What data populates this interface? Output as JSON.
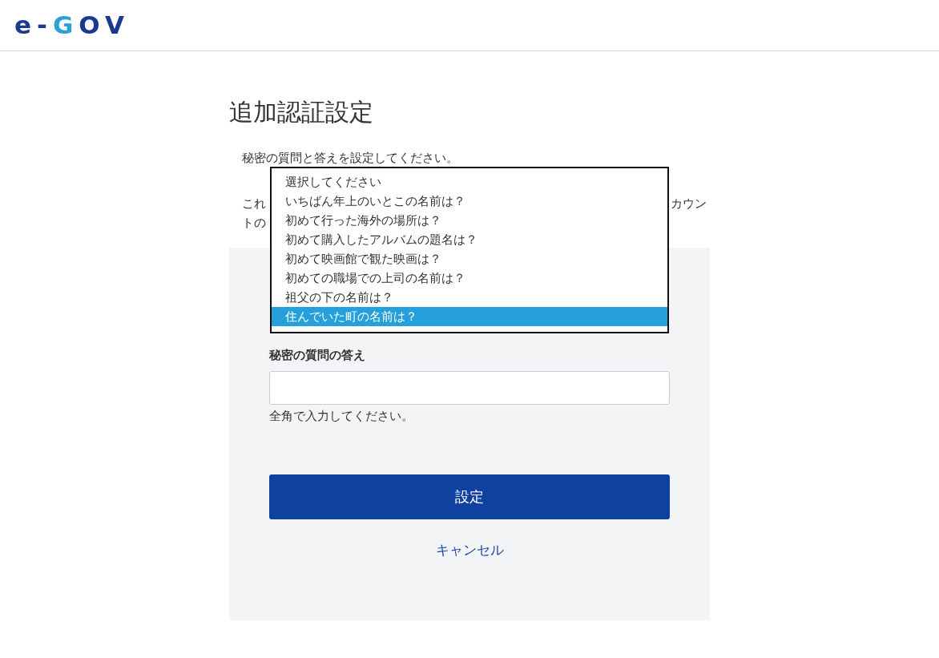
{
  "logo": {
    "parts": [
      {
        "text": "e-",
        "color": "#1b3a8f"
      },
      {
        "text": "G",
        "color": "#2a9fd8"
      },
      {
        "text": "OV",
        "color": "#1b3a8f"
      }
    ]
  },
  "title": "追加認証設定",
  "instruction": "秘密の質問と答えを設定してください。",
  "paragraph_fragments": [
    {
      "left": "これ",
      "right": "カウン"
    },
    {
      "left": "トの"
    }
  ],
  "dropdown": {
    "options": [
      {
        "label": "選択してください",
        "selected": false
      },
      {
        "label": "いちばん年上のいとこの名前は？",
        "selected": false
      },
      {
        "label": "初めて行った海外の場所は？",
        "selected": false
      },
      {
        "label": "初めて購入したアルバムの題名は？",
        "selected": false
      },
      {
        "label": "初めて映画館で観た映画は？",
        "selected": false
      },
      {
        "label": "初めての職場での上司の名前は？",
        "selected": false
      },
      {
        "label": "祖父の下の名前は？",
        "selected": false
      },
      {
        "label": "住んでいた町の名前は？",
        "selected": true
      }
    ]
  },
  "answer": {
    "label": "秘密の質問の答え",
    "hint": "全角で入力してください。"
  },
  "submit_button": "設定",
  "cancel_link": "キャンセル"
}
